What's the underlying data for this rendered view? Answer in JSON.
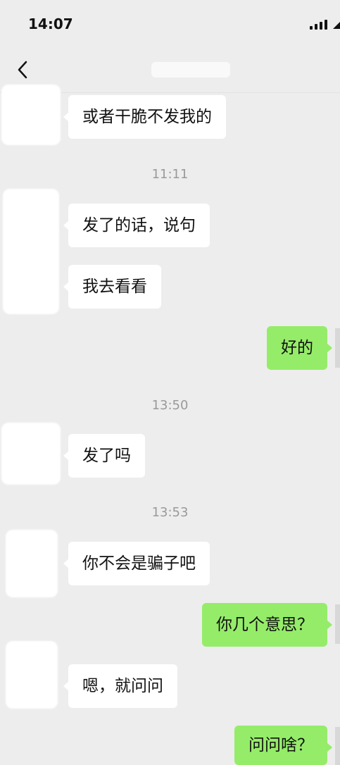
{
  "status_bar": {
    "time": "14:07"
  },
  "nav": {
    "back_icon": "chevron-left-icon"
  },
  "messages": [
    {
      "side": "in",
      "text": "或者干脆不发我的"
    },
    {
      "type": "timestamp",
      "text": "11:11"
    },
    {
      "side": "in",
      "text": "发了的话，说句"
    },
    {
      "side": "in",
      "text": "我去看看"
    },
    {
      "side": "out",
      "text": "好的"
    },
    {
      "type": "timestamp",
      "text": "13:50"
    },
    {
      "side": "in",
      "text": "发了吗"
    },
    {
      "type": "timestamp",
      "text": "13:53"
    },
    {
      "side": "in",
      "text": "你不会是骗子吧"
    },
    {
      "side": "out",
      "text": "你几个意思？"
    },
    {
      "side": "in",
      "text": "嗯，就问问"
    },
    {
      "side": "out",
      "text": "问问啥？"
    }
  ],
  "colors": {
    "background": "#ededed",
    "incoming_bubble": "#ffffff",
    "outgoing_bubble": "#95ec69",
    "timestamp": "#9a9a9a"
  }
}
